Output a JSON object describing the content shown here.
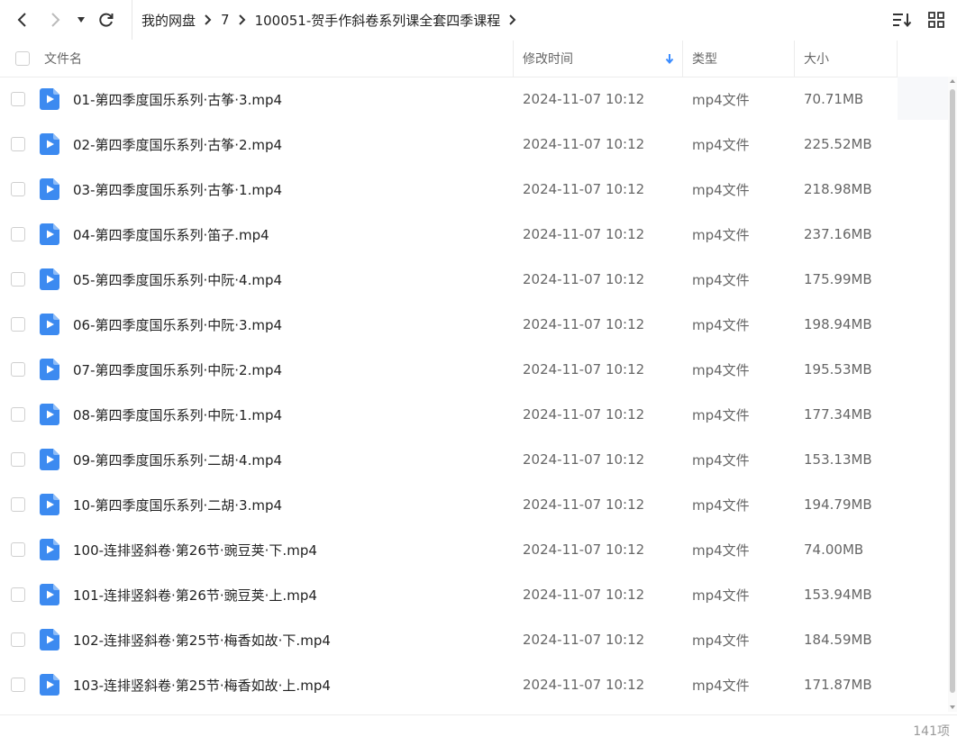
{
  "breadcrumb": [
    "我的网盘",
    "7",
    "100051-贺手作斜卷系列课全套四季课程"
  ],
  "columns": {
    "name": "文件名",
    "modified": "修改时间",
    "type": "类型",
    "size": "大小"
  },
  "files": [
    {
      "name": "01-第四季度国乐系列·古筝·3.mp4",
      "modified": "2024-11-07 10:12",
      "type": "mp4文件",
      "size": "70.71MB"
    },
    {
      "name": "02-第四季度国乐系列·古筝·2.mp4",
      "modified": "2024-11-07 10:12",
      "type": "mp4文件",
      "size": "225.52MB"
    },
    {
      "name": "03-第四季度国乐系列·古筝·1.mp4",
      "modified": "2024-11-07 10:12",
      "type": "mp4文件",
      "size": "218.98MB"
    },
    {
      "name": "04-第四季度国乐系列·笛子.mp4",
      "modified": "2024-11-07 10:12",
      "type": "mp4文件",
      "size": "237.16MB"
    },
    {
      "name": "05-第四季度国乐系列·中阮·4.mp4",
      "modified": "2024-11-07 10:12",
      "type": "mp4文件",
      "size": "175.99MB"
    },
    {
      "name": "06-第四季度国乐系列·中阮·3.mp4",
      "modified": "2024-11-07 10:12",
      "type": "mp4文件",
      "size": "198.94MB"
    },
    {
      "name": "07-第四季度国乐系列·中阮·2.mp4",
      "modified": "2024-11-07 10:12",
      "type": "mp4文件",
      "size": "195.53MB"
    },
    {
      "name": "08-第四季度国乐系列·中阮·1.mp4",
      "modified": "2024-11-07 10:12",
      "type": "mp4文件",
      "size": "177.34MB"
    },
    {
      "name": "09-第四季度国乐系列·二胡·4.mp4",
      "modified": "2024-11-07 10:12",
      "type": "mp4文件",
      "size": "153.13MB"
    },
    {
      "name": "10-第四季度国乐系列·二胡·3.mp4",
      "modified": "2024-11-07 10:12",
      "type": "mp4文件",
      "size": "194.79MB"
    },
    {
      "name": "100-连排竖斜卷·第26节·豌豆荚·下.mp4",
      "modified": "2024-11-07 10:12",
      "type": "mp4文件",
      "size": "74.00MB"
    },
    {
      "name": "101-连排竖斜卷·第26节·豌豆荚·上.mp4",
      "modified": "2024-11-07 10:12",
      "type": "mp4文件",
      "size": "153.94MB"
    },
    {
      "name": "102-连排竖斜卷·第25节·梅香如故·下.mp4",
      "modified": "2024-11-07 10:12",
      "type": "mp4文件",
      "size": "184.59MB"
    },
    {
      "name": "103-连排竖斜卷·第25节·梅香如故·上.mp4",
      "modified": "2024-11-07 10:12",
      "type": "mp4文件",
      "size": "171.87MB"
    }
  ],
  "status": {
    "count": "141项"
  },
  "colors": {
    "accent": "#3b8cff",
    "file_icon": "#3c8af0"
  },
  "icons": {
    "back": "chevron-left-icon",
    "forward": "chevron-right-icon",
    "history": "caret-down-icon",
    "refresh": "refresh-icon",
    "sort": "sort-icon",
    "view": "grid-view-icon",
    "file": "video-file-icon",
    "sort_arrow": "arrow-down-icon"
  }
}
